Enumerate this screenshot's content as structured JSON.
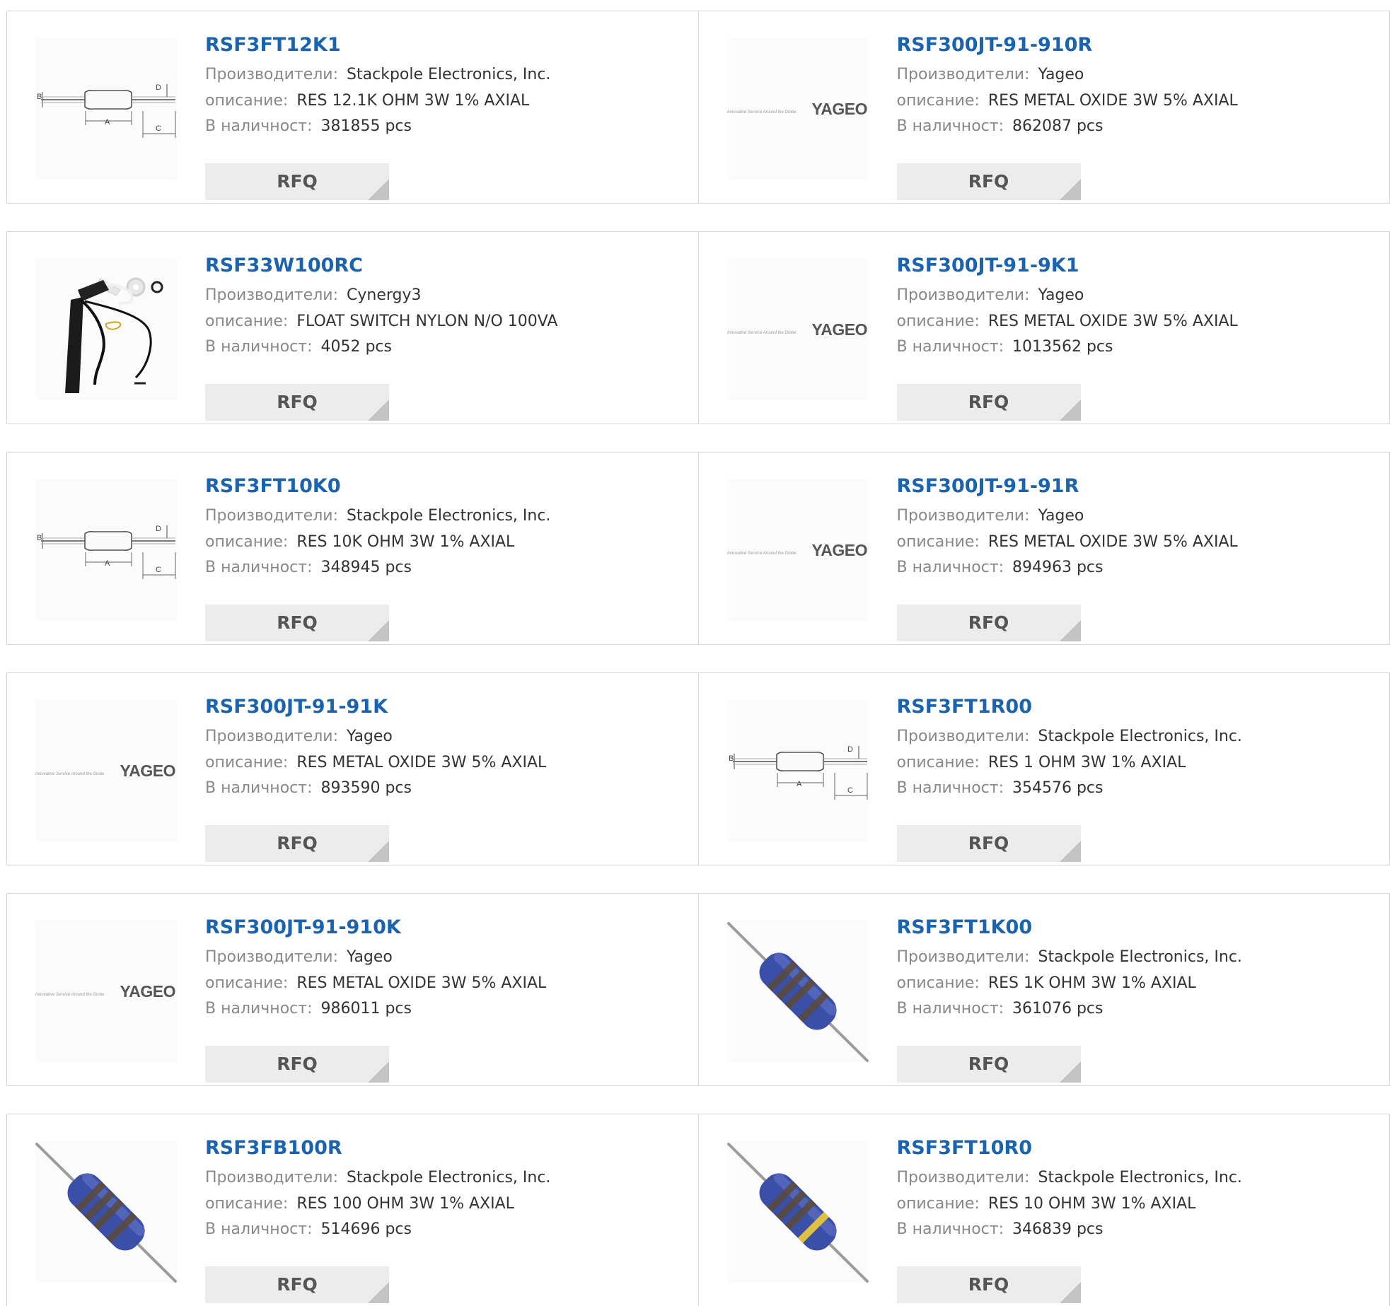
{
  "rows": [
    [
      {
        "part_number": "RSF3FT12K1",
        "manufacturer_label": "Производители:",
        "manufacturer": "Stackpole Electronics, Inc.",
        "description_label": "описание:",
        "description": "RES 12.1K OHM 3W 1% AXIAL",
        "stock_label": "В наличност:",
        "stock": "381855 pcs",
        "rfq_label": "RFQ",
        "image": "resistor-dimension-drawing"
      },
      {
        "part_number": "RSF300JT-91-910R",
        "manufacturer_label": "Производители:",
        "manufacturer": "Yageo",
        "description_label": "описание:",
        "description": "RES METAL OXIDE 3W 5% AXIAL",
        "stock_label": "В наличност:",
        "stock": "862087 pcs",
        "rfq_label": "RFQ",
        "image": "yageo-logo"
      }
    ],
    [
      {
        "part_number": "RSF33W100RC",
        "manufacturer_label": "Производители:",
        "manufacturer": "Cynergy3",
        "description_label": "описание:",
        "description": "FLOAT SWITCH NYLON N/O 100VA",
        "stock_label": "В наличност:",
        "stock": "4052 pcs",
        "rfq_label": "RFQ",
        "image": "float-switch"
      },
      {
        "part_number": "RSF300JT-91-9K1",
        "manufacturer_label": "Производители:",
        "manufacturer": "Yageo",
        "description_label": "описание:",
        "description": "RES METAL OXIDE 3W 5% AXIAL",
        "stock_label": "В наличност:",
        "stock": "1013562 pcs",
        "rfq_label": "RFQ",
        "image": "yageo-logo"
      }
    ],
    [
      {
        "part_number": "RSF3FT10K0",
        "manufacturer_label": "Производители:",
        "manufacturer": "Stackpole Electronics, Inc.",
        "description_label": "описание:",
        "description": "RES 10K OHM 3W 1% AXIAL",
        "stock_label": "В наличност:",
        "stock": "348945 pcs",
        "rfq_label": "RFQ",
        "image": "resistor-dimension-drawing"
      },
      {
        "part_number": "RSF300JT-91-91R",
        "manufacturer_label": "Производители:",
        "manufacturer": "Yageo",
        "description_label": "описание:",
        "description": "RES METAL OXIDE 3W 5% AXIAL",
        "stock_label": "В наличност:",
        "stock": "894963 pcs",
        "rfq_label": "RFQ",
        "image": "yageo-logo"
      }
    ],
    [
      {
        "part_number": "RSF300JT-91-91K",
        "manufacturer_label": "Производители:",
        "manufacturer": "Yageo",
        "description_label": "описание:",
        "description": "RES METAL OXIDE 3W 5% AXIAL",
        "stock_label": "В наличност:",
        "stock": "893590 pcs",
        "rfq_label": "RFQ",
        "image": "yageo-logo"
      },
      {
        "part_number": "RSF3FT1R00",
        "manufacturer_label": "Производители:",
        "manufacturer": "Stackpole Electronics, Inc.",
        "description_label": "описание:",
        "description": "RES 1 OHM 3W 1% AXIAL",
        "stock_label": "В наличност:",
        "stock": "354576 pcs",
        "rfq_label": "RFQ",
        "image": "resistor-dimension-drawing"
      }
    ],
    [
      {
        "part_number": "RSF300JT-91-910K",
        "manufacturer_label": "Производители:",
        "manufacturer": "Yageo",
        "description_label": "описание:",
        "description": "RES METAL OXIDE 3W 5% AXIAL",
        "stock_label": "В наличност:",
        "stock": "986011 pcs",
        "rfq_label": "RFQ",
        "image": "yageo-logo"
      },
      {
        "part_number": "RSF3FT1K00",
        "manufacturer_label": "Производители:",
        "manufacturer": "Stackpole Electronics, Inc.",
        "description_label": "описание:",
        "description": "RES 1K OHM 3W 1% AXIAL",
        "stock_label": "В наличност:",
        "stock": "361076 pcs",
        "rfq_label": "RFQ",
        "image": "blue-resistor-photo"
      }
    ],
    [
      {
        "part_number": "RSF3FB100R",
        "manufacturer_label": "Производители:",
        "manufacturer": "Stackpole Electronics, Inc.",
        "description_label": "описание:",
        "description": "RES 100 OHM 3W 1% AXIAL",
        "stock_label": "В наличност:",
        "stock": "514696 pcs",
        "rfq_label": "RFQ",
        "image": "blue-resistor-photo"
      },
      {
        "part_number": "RSF3FT10R0",
        "manufacturer_label": "Производители:",
        "manufacturer": "Stackpole Electronics, Inc.",
        "description_label": "описание:",
        "description": "RES 10 OHM 3W 1% AXIAL",
        "stock_label": "В наличност:",
        "stock": "346839 pcs",
        "rfq_label": "RFQ",
        "image": "blue-resistor-gold-band-photo"
      }
    ]
  ],
  "logo_texts": {
    "yageo_tagline": "Innovative Service Around the Globe",
    "yageo_name": "YAGEO"
  },
  "drawing_labels": {
    "a": "A",
    "b": "B",
    "c": "C",
    "d": "D"
  },
  "colors": {
    "part_link": "#1a63b0",
    "label_gray": "#888888",
    "value_text": "#333333",
    "rfq_bg": "#ececec",
    "border": "#d6d6d6",
    "resistor_blue": "#3a4fa8"
  }
}
